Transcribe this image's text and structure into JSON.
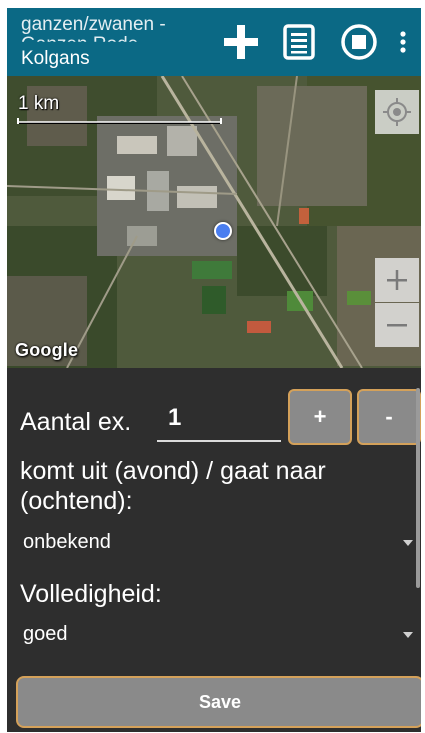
{
  "appbar": {
    "title_line1": "ganzen/zwanen -",
    "title_line2": "Ganzen Rode",
    "title_line3": "Kolgans",
    "icons": [
      "add-icon",
      "list-icon",
      "stop-icon",
      "more-vert-icon"
    ]
  },
  "map": {
    "scale_label": "1 km",
    "logo": "Google",
    "zoom_in": "+",
    "zoom_out": "−"
  },
  "form": {
    "count_label": "Aantal ex.",
    "count_value": "1",
    "plus_label": "+",
    "minus_label": "-",
    "origin_label": "komt uit (avond) / gaat naar (ochtend):",
    "origin_value": "onbekend",
    "complete_label": "Volledigheid:",
    "complete_value": "goed",
    "save_label": "Save"
  },
  "colors": {
    "appbar": "#0b6985",
    "background": "#2e2e2e",
    "button": "#8a8a8a",
    "button_border": "#d4a15a",
    "location_dot": "#4a7ef0"
  }
}
